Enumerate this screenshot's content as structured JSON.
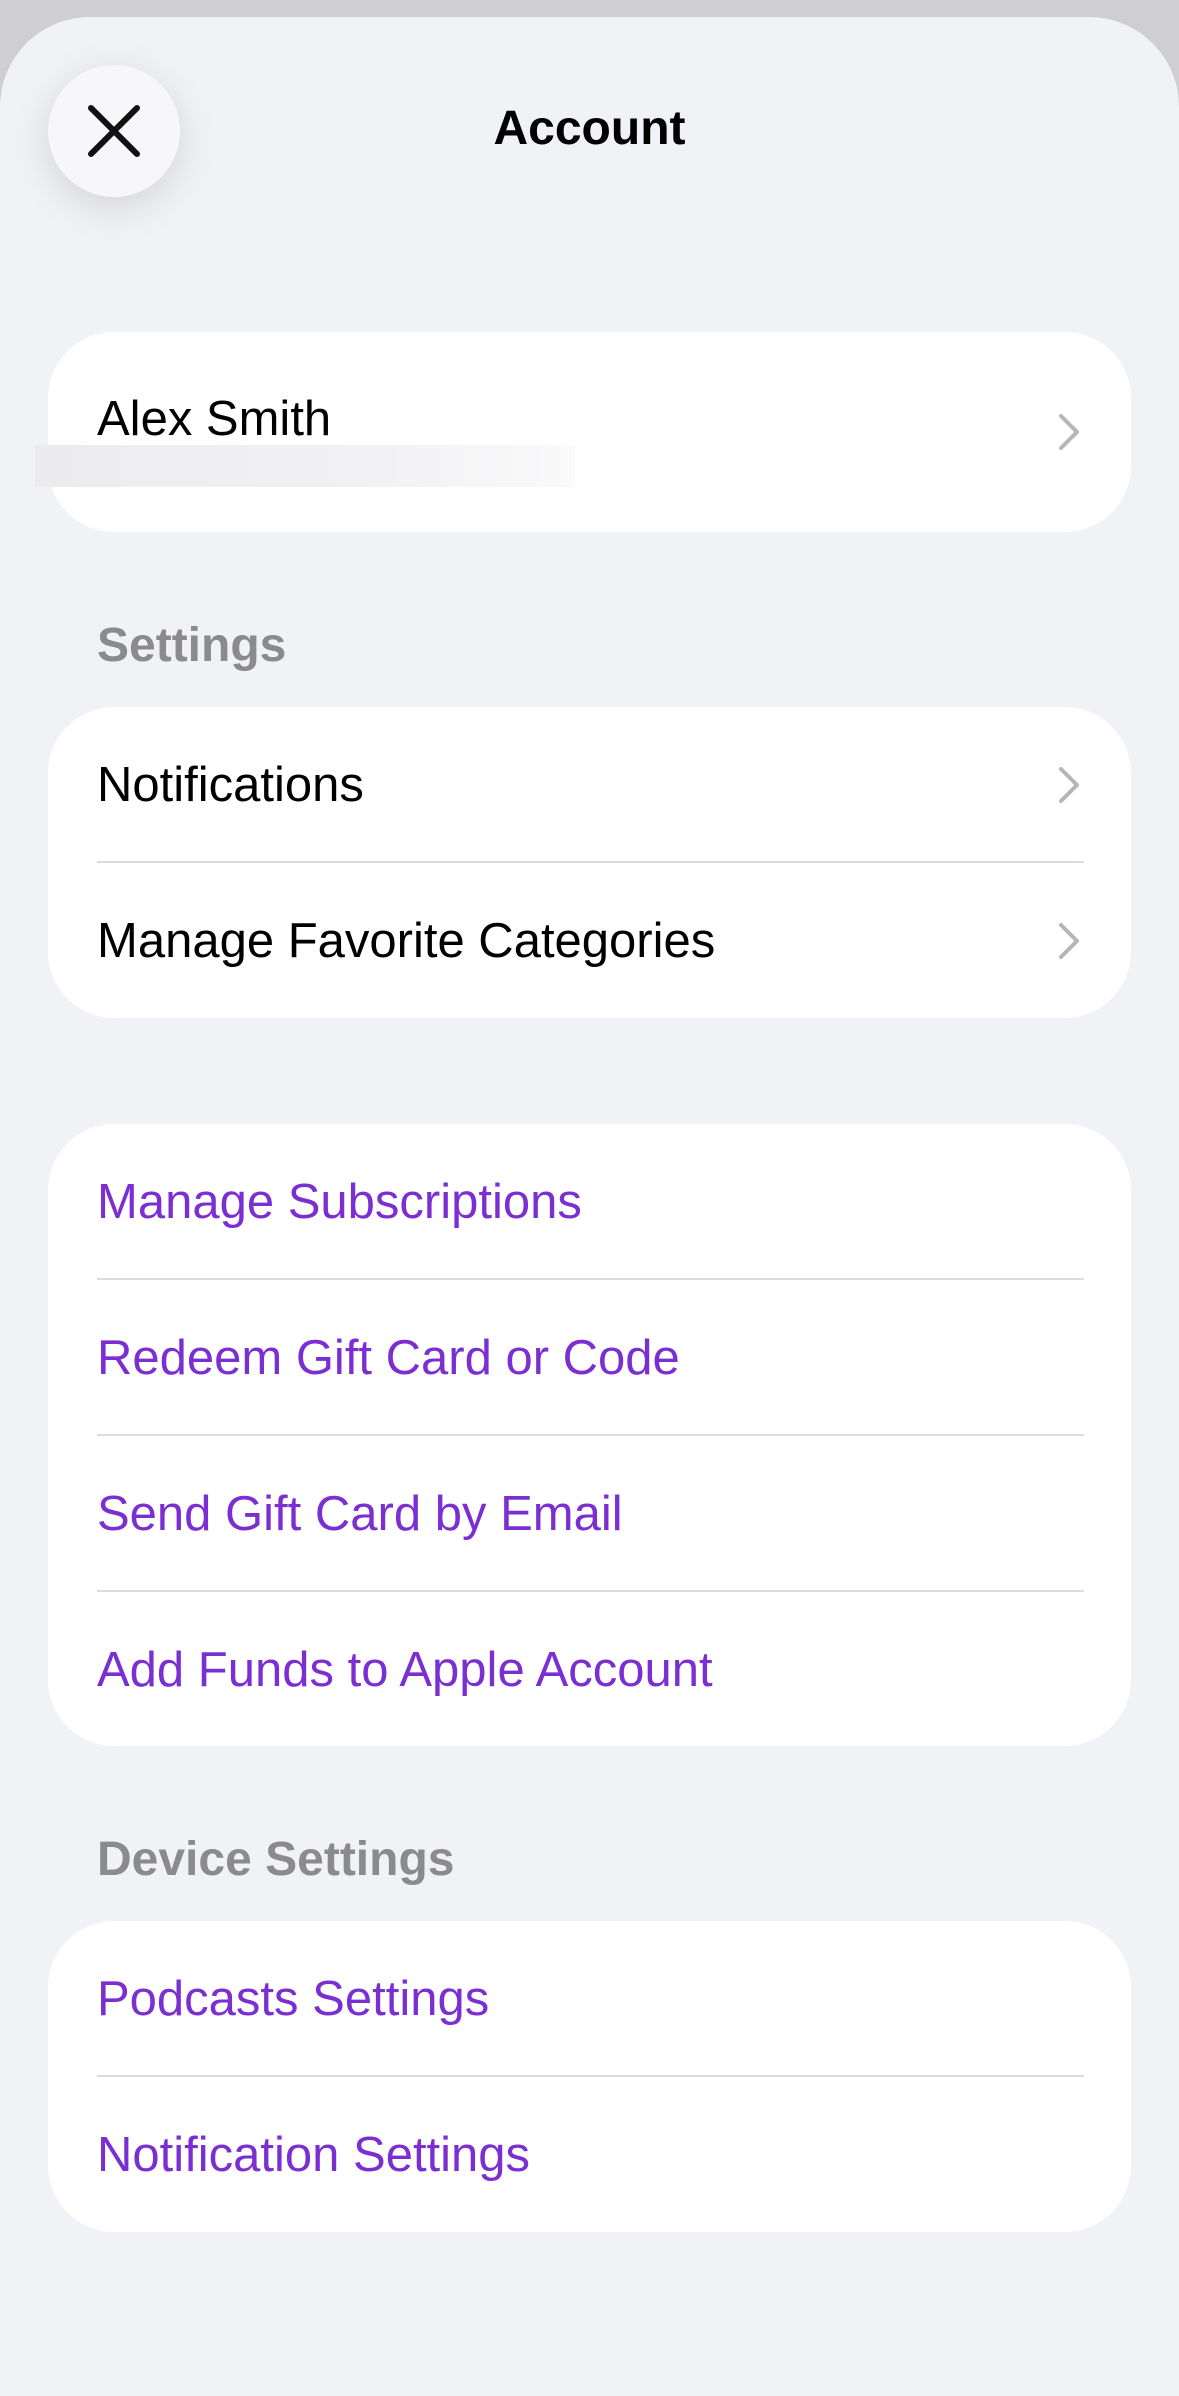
{
  "header": {
    "title": "Account"
  },
  "profile": {
    "name": "Alex Smith"
  },
  "settings": {
    "header": "Settings",
    "items": [
      {
        "label": "Notifications"
      },
      {
        "label": "Manage Favorite Categories"
      }
    ]
  },
  "actions": {
    "items": [
      {
        "label": "Manage Subscriptions"
      },
      {
        "label": "Redeem Gift Card or Code"
      },
      {
        "label": "Send Gift Card by Email"
      },
      {
        "label": "Add Funds to Apple Account"
      }
    ]
  },
  "device_settings": {
    "header": "Device Settings",
    "items": [
      {
        "label": "Podcasts Settings"
      },
      {
        "label": "Notification Settings"
      }
    ]
  },
  "colors": {
    "accent": "#7b2fd2",
    "background": "#f1f2f6",
    "card": "#ffffff",
    "section_header": "#8a8a8f"
  },
  "icons": {
    "close": "close-icon",
    "chevron": "chevron-right-icon"
  }
}
